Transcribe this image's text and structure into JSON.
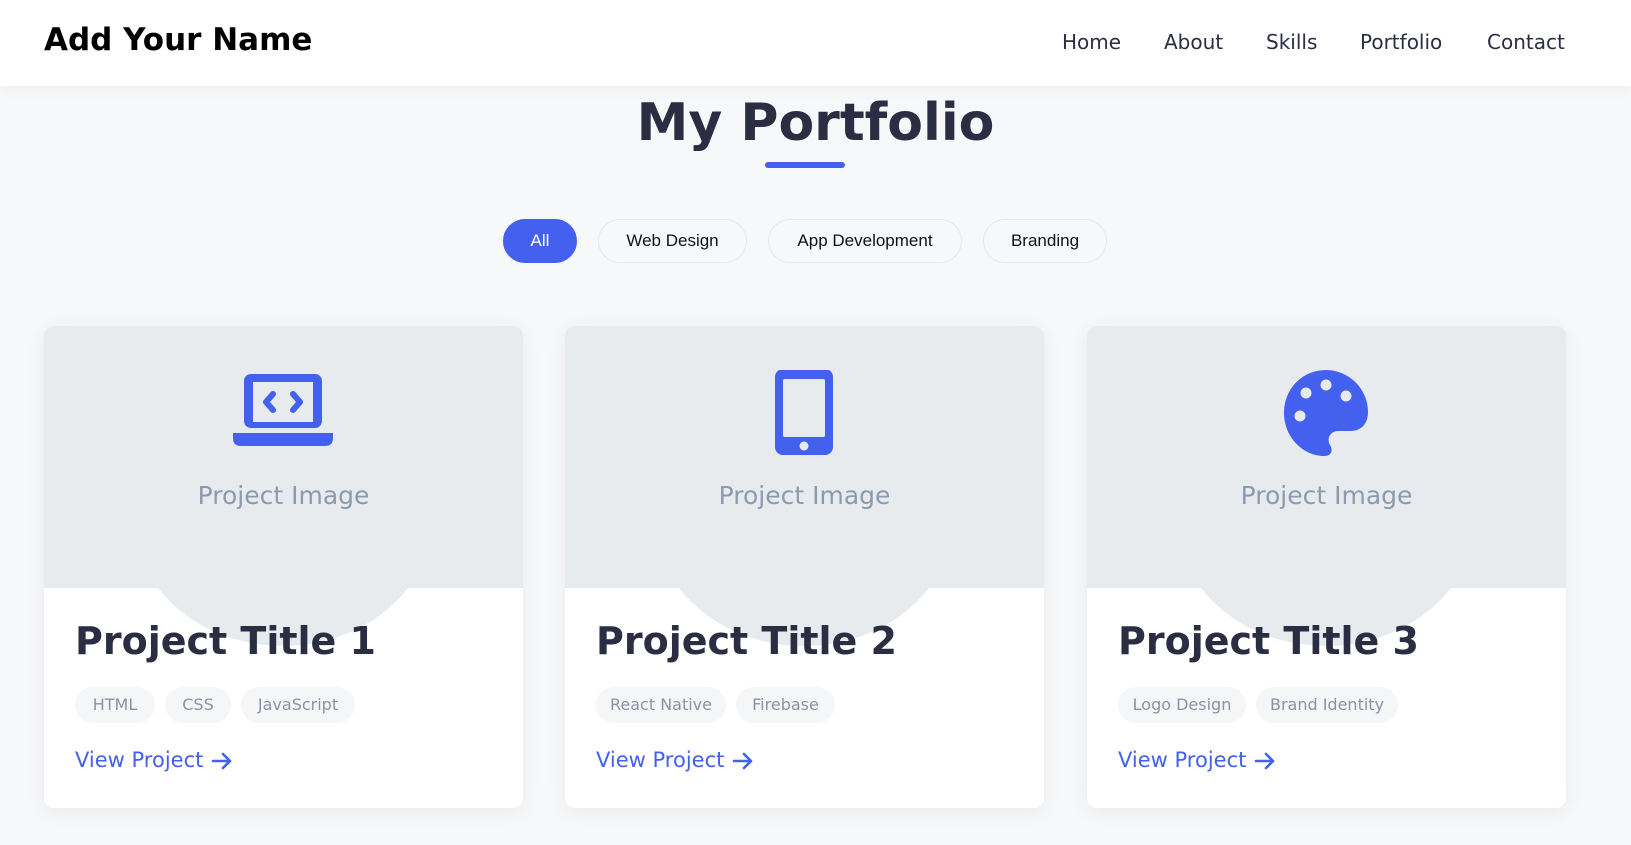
{
  "header": {
    "brand": "Add Your Name",
    "nav": [
      "Home",
      "About",
      "Skills",
      "Portfolio",
      "Contact"
    ]
  },
  "portfolio": {
    "title": "My Portfolio",
    "filters": [
      "All",
      "Web Design",
      "App Development",
      "Branding"
    ],
    "active_filter": "All",
    "projects": [
      {
        "icon": "laptop-code-icon",
        "image_label": "Project Image",
        "title": "Project Title 1",
        "tags": [
          "HTML",
          "CSS",
          "JavaScript"
        ],
        "link": "View Project"
      },
      {
        "icon": "mobile-phone-icon",
        "image_label": "Project Image",
        "title": "Project Title 2",
        "tags": [
          "React Native",
          "Firebase"
        ],
        "link": "View Project"
      },
      {
        "icon": "palette-icon",
        "image_label": "Project Image",
        "title": "Project Title 3",
        "tags": [
          "Logo Design",
          "Brand Identity"
        ],
        "link": "View Project"
      }
    ]
  },
  "colors": {
    "accent": "#4361ee",
    "image_placeholder": "#e8ebee",
    "background": "#f7f8fa"
  }
}
